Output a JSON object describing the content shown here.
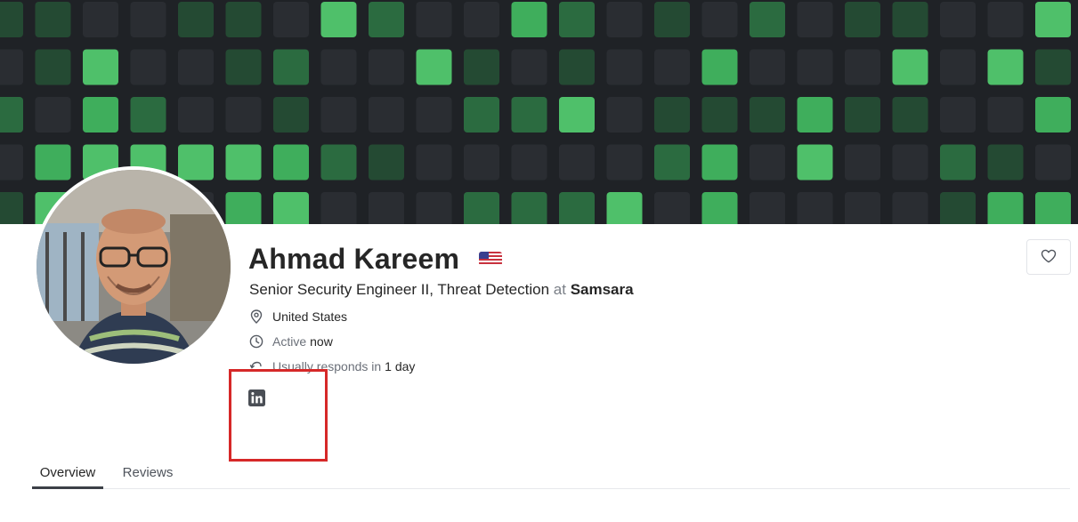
{
  "profile": {
    "name": "Ahmad Kareem",
    "flag_icon": "us-flag-icon",
    "title": "Senior Security Engineer II, Threat Detection",
    "at_word": "at",
    "company": "Samsara",
    "location": "United States",
    "active_label": "Active",
    "active_value": "now",
    "responds_label": "Usually responds in",
    "responds_value": "1 day",
    "social_icon": "linkedin-icon"
  },
  "actions": {
    "favorite_icon": "heart-icon"
  },
  "tabs": [
    {
      "label": "Overview",
      "active": true
    },
    {
      "label": "Reviews",
      "active": false
    }
  ],
  "colors": {
    "banner_bg": "#1f2226",
    "accent_green": "#3fae5c",
    "highlight_red": "#d62828"
  }
}
